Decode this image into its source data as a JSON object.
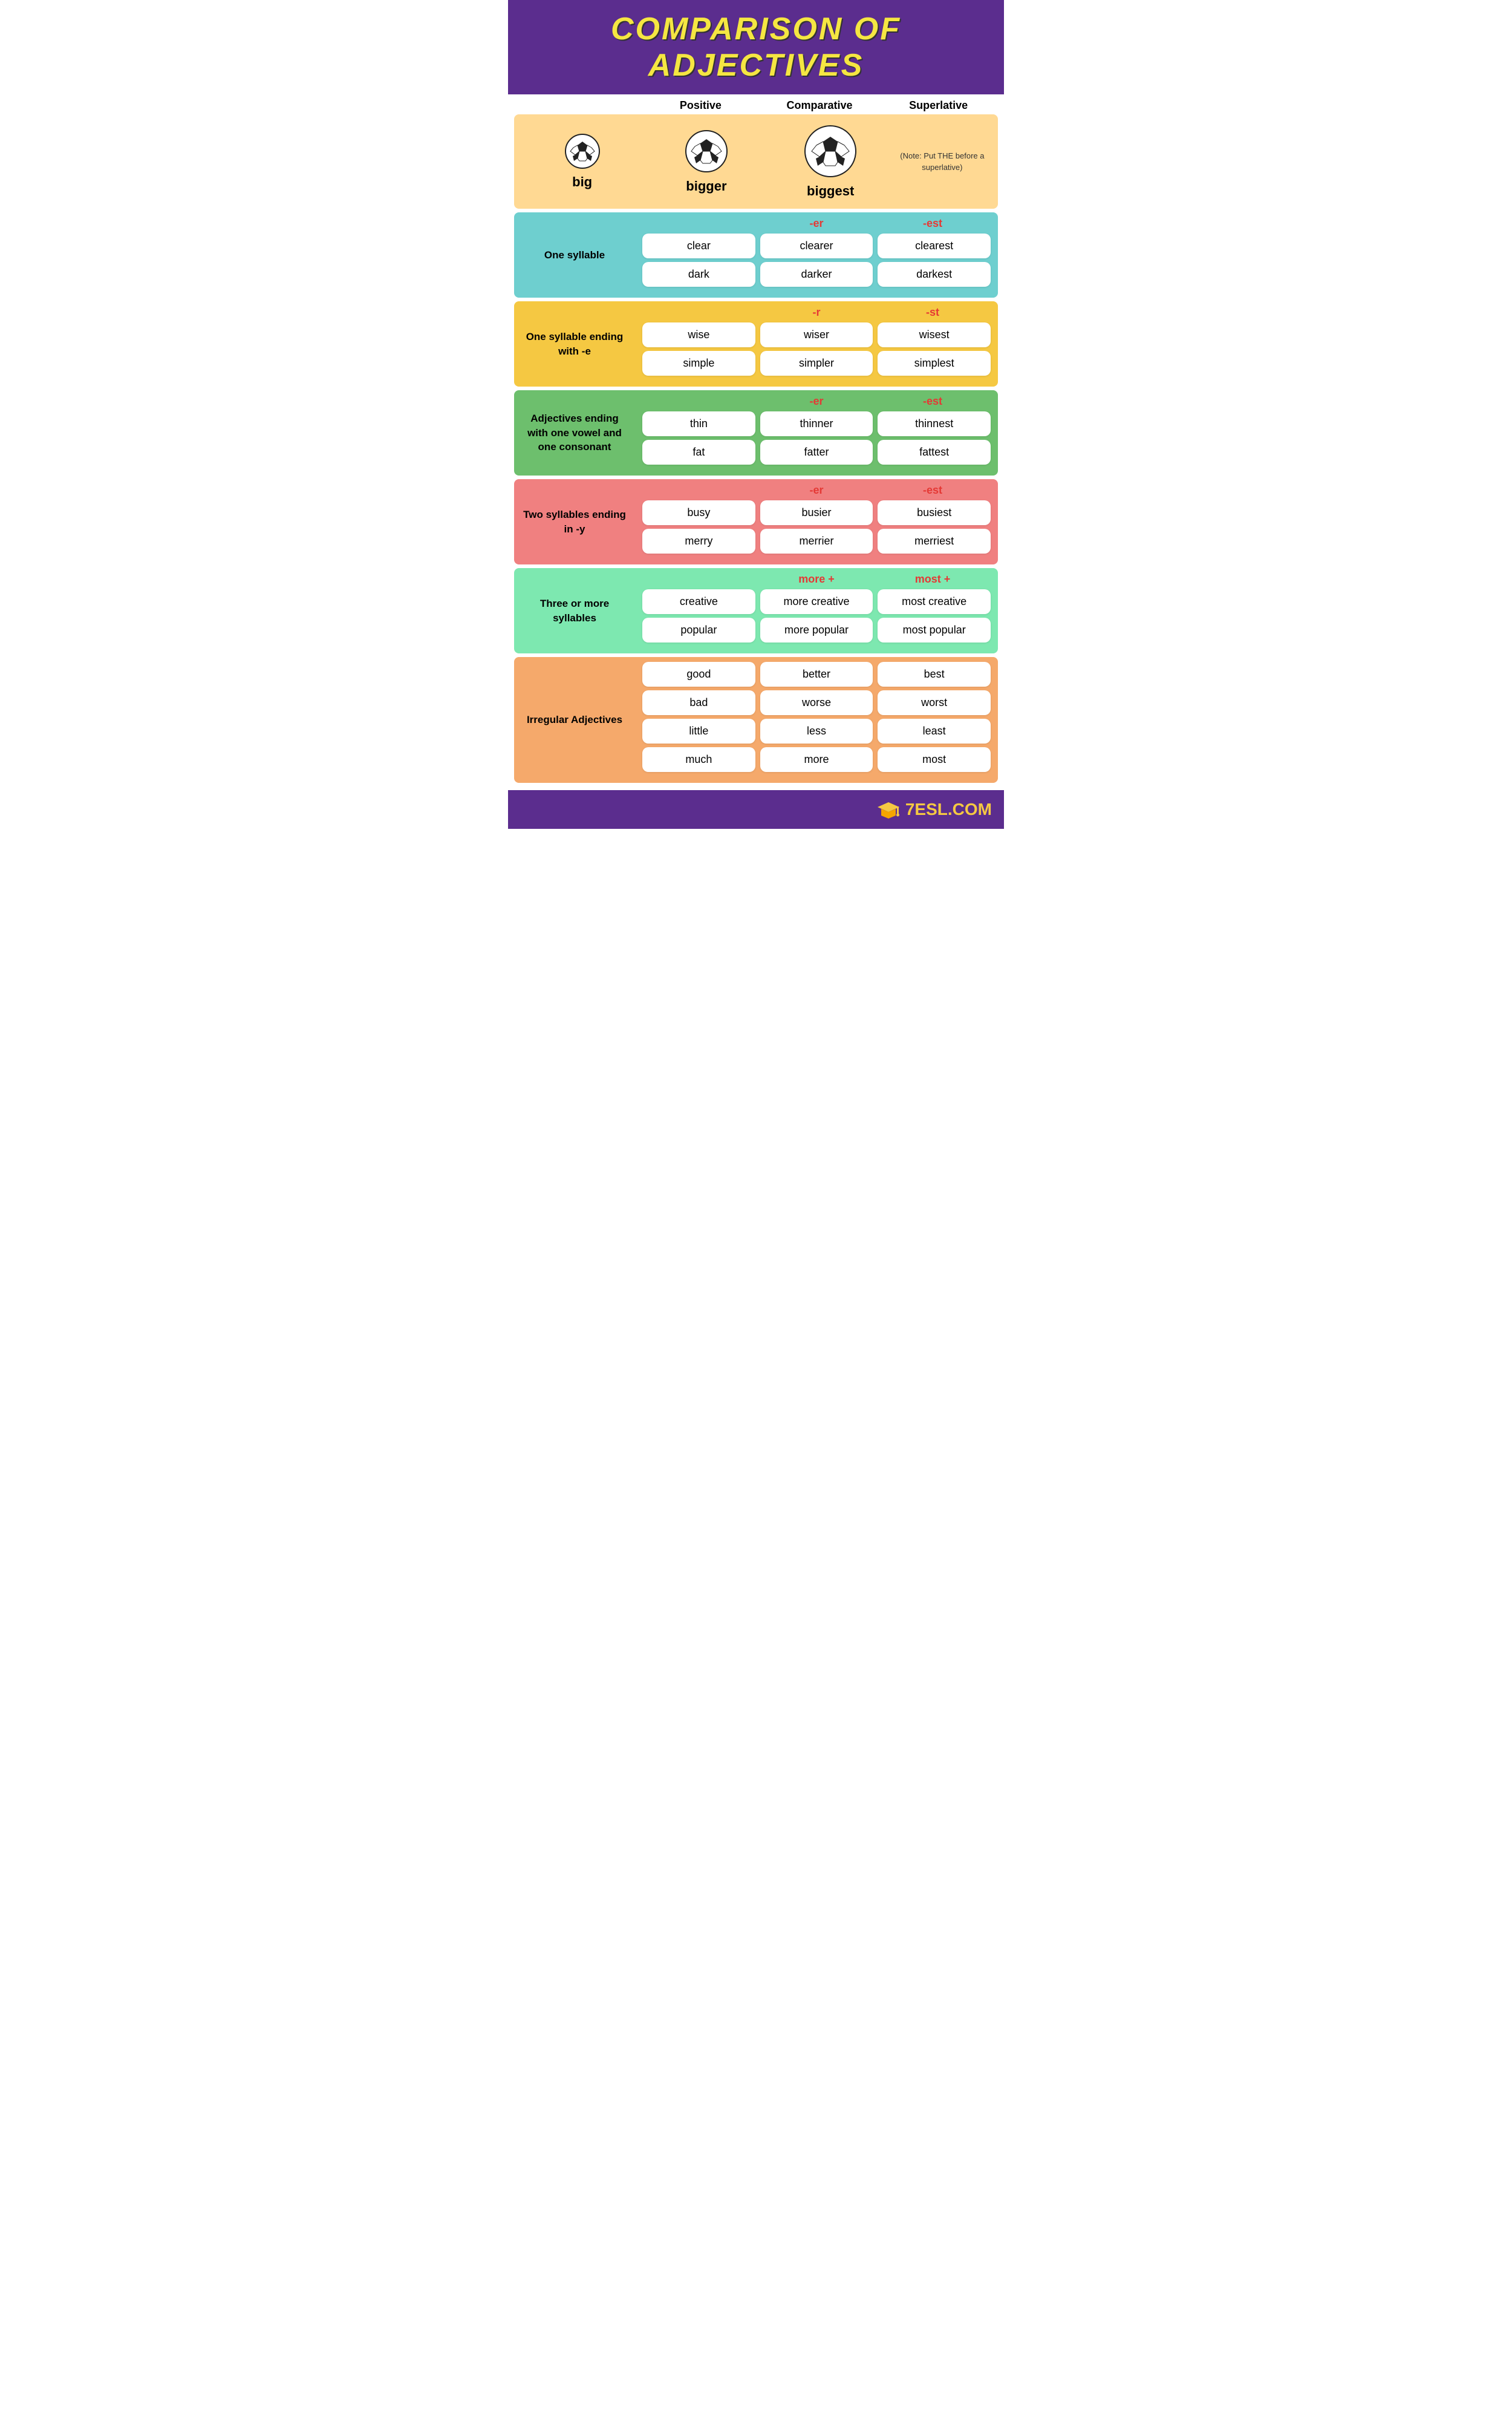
{
  "header": {
    "title": "COMPARISON OF ADJECTIVES"
  },
  "columns": {
    "positive": "Positive",
    "comparative": "Comparative",
    "superlative": "Superlative"
  },
  "intro": {
    "positive": "big",
    "comparative": "bigger",
    "superlative": "biggest",
    "note": "(Note: Put THE before a superlative)"
  },
  "sections": [
    {
      "id": "one-syllable",
      "label": "One\nsyllable",
      "color": "teal",
      "suffix_comparative": "-er",
      "suffix_superlative": "-est",
      "rows": [
        {
          "positive": "clear",
          "comparative": "clearer",
          "superlative": "clearest"
        },
        {
          "positive": "dark",
          "comparative": "darker",
          "superlative": "darkest"
        }
      ]
    },
    {
      "id": "one-syllable-e",
      "label": "One syllable\nending with -e",
      "color": "yellow",
      "suffix_comparative": "-r",
      "suffix_superlative": "-st",
      "rows": [
        {
          "positive": "wise",
          "comparative": "wiser",
          "superlative": "wisest"
        },
        {
          "positive": "simple",
          "comparative": "simpler",
          "superlative": "simplest"
        }
      ]
    },
    {
      "id": "vowel-consonant",
      "label": "Adjectives ending\nwith one vowel and\none consonant",
      "color": "green",
      "suffix_comparative": "-er",
      "suffix_superlative": "-est",
      "rows": [
        {
          "positive": "thin",
          "comparative": "thinner",
          "superlative": "thinnest"
        },
        {
          "positive": "fat",
          "comparative": "fatter",
          "superlative": "fattest"
        }
      ]
    },
    {
      "id": "two-syllables-y",
      "label": "Two syllables\nending in -y",
      "color": "pink",
      "suffix_comparative": "-er",
      "suffix_superlative": "-est",
      "rows": [
        {
          "positive": "busy",
          "comparative": "busier",
          "superlative": "busiest"
        },
        {
          "positive": "merry",
          "comparative": "merrier",
          "superlative": "merriest"
        }
      ]
    },
    {
      "id": "three-syllables",
      "label": "Three or more\nsyllables",
      "color": "mint",
      "suffix_comparative": "more +",
      "suffix_superlative": "most +",
      "rows": [
        {
          "positive": "creative",
          "comparative": "more creative",
          "superlative": "most creative"
        },
        {
          "positive": "popular",
          "comparative": "more popular",
          "superlative": "most popular"
        }
      ]
    },
    {
      "id": "irregular",
      "label": "Irregular\nAdjectives",
      "color": "orange",
      "suffix_comparative": "",
      "suffix_superlative": "",
      "rows": [
        {
          "positive": "good",
          "comparative": "better",
          "superlative": "best"
        },
        {
          "positive": "bad",
          "comparative": "worse",
          "superlative": "worst"
        },
        {
          "positive": "little",
          "comparative": "less",
          "superlative": "least"
        },
        {
          "positive": "much",
          "comparative": "more",
          "superlative": "most"
        }
      ]
    }
  ],
  "footer": {
    "logo": "7ESL.COM"
  },
  "colors": {
    "teal": "#6ecfcf",
    "yellow": "#f5c842",
    "green": "#6dbf6d",
    "pink": "#f08080",
    "mint": "#7de8b0",
    "orange": "#f5a96b",
    "header_bg": "#5b2d8e",
    "header_text": "#f5e642",
    "intro_bg": "#ffd993",
    "suffix_color": "#e53935"
  }
}
